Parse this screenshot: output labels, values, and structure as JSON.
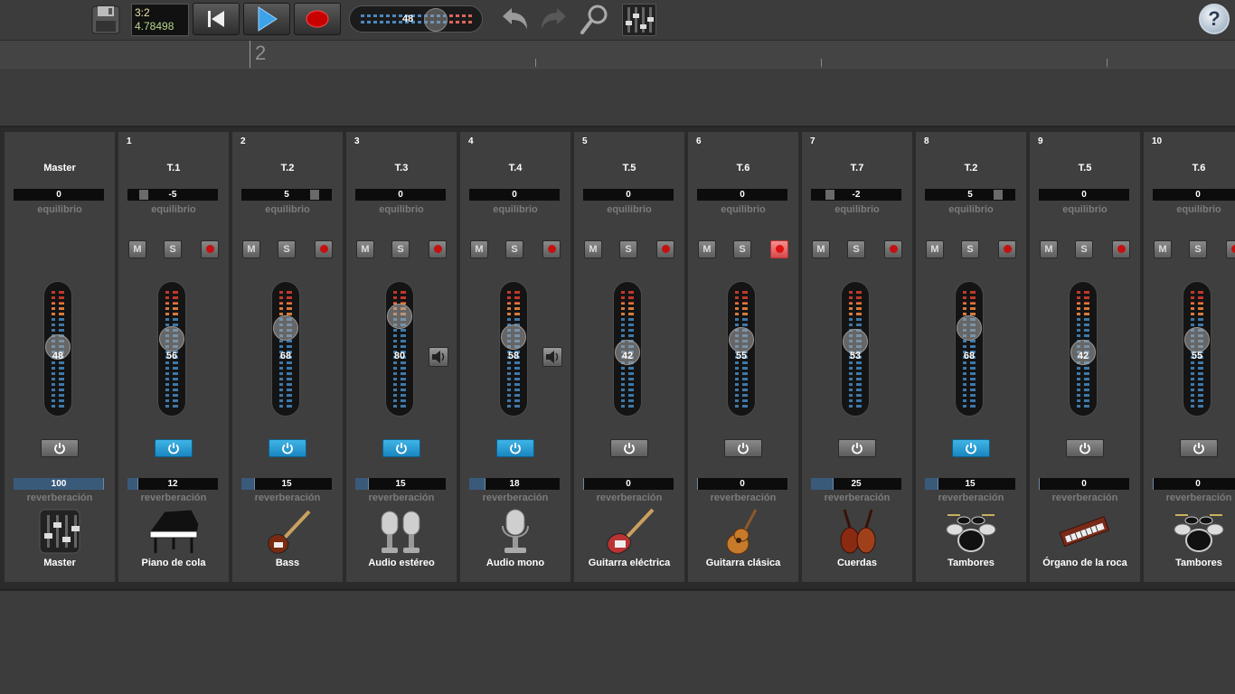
{
  "toolbar": {
    "timecode": {
      "bar_beat": "3:2",
      "seconds": "4.78498"
    },
    "tempo": "48"
  },
  "ruler": {
    "bar_number": "2"
  },
  "labels": {
    "balance": "equilibrio",
    "reverb": "reverberación",
    "mute": "M",
    "solo": "S"
  },
  "colors": {
    "power_on": "#2a9ad6",
    "record_armed": "#e06060",
    "meter_low": "#3e78a8",
    "meter_high": "#c0392b"
  },
  "strips": [
    {
      "number": "",
      "name": "Master",
      "balance": "0",
      "volume": "48",
      "reverb": "100",
      "reverb_level": 1.0,
      "power_on": false,
      "armed": false,
      "monitor": false,
      "instrument_name": "Master",
      "icon": "mixer-icon"
    },
    {
      "number": "1",
      "name": "T.1",
      "balance": "-5",
      "volume": "56",
      "reverb": "12",
      "reverb_level": 0.12,
      "power_on": true,
      "armed": false,
      "monitor": false,
      "instrument_name": "Piano de cola",
      "icon": "grand-piano-icon"
    },
    {
      "number": "2",
      "name": "T.2",
      "balance": "5",
      "volume": "68",
      "reverb": "15",
      "reverb_level": 0.15,
      "power_on": true,
      "armed": false,
      "monitor": false,
      "instrument_name": "Bass",
      "icon": "bass-guitar-icon"
    },
    {
      "number": "3",
      "name": "T.3",
      "balance": "0",
      "volume": "80",
      "reverb": "15",
      "reverb_level": 0.15,
      "power_on": true,
      "armed": false,
      "monitor": true,
      "instrument_name": "Audio estéreo",
      "icon": "stereo-microphone-icon"
    },
    {
      "number": "4",
      "name": "T.4",
      "balance": "0",
      "volume": "58",
      "reverb": "18",
      "reverb_level": 0.18,
      "power_on": true,
      "armed": false,
      "monitor": true,
      "instrument_name": "Audio mono",
      "icon": "microphone-icon"
    },
    {
      "number": "5",
      "name": "T.5",
      "balance": "0",
      "volume": "42",
      "reverb": "0",
      "reverb_level": 0,
      "power_on": false,
      "armed": false,
      "monitor": false,
      "instrument_name": "Guitarra eléctrica",
      "icon": "electric-guitar-icon"
    },
    {
      "number": "6",
      "name": "T.6",
      "balance": "0",
      "volume": "55",
      "reverb": "0",
      "reverb_level": 0,
      "power_on": false,
      "armed": true,
      "monitor": false,
      "instrument_name": "Guitarra clásica",
      "icon": "acoustic-guitar-icon"
    },
    {
      "number": "7",
      "name": "T.7",
      "balance": "-2",
      "volume": "53",
      "reverb": "25",
      "reverb_level": 0.25,
      "power_on": false,
      "armed": false,
      "monitor": false,
      "instrument_name": "Cuerdas",
      "icon": "violin-icon"
    },
    {
      "number": "8",
      "name": "T.2",
      "balance": "5",
      "volume": "68",
      "reverb": "15",
      "reverb_level": 0.15,
      "power_on": true,
      "armed": false,
      "monitor": false,
      "instrument_name": "Tambores",
      "icon": "drum-kit-icon"
    },
    {
      "number": "9",
      "name": "T.5",
      "balance": "0",
      "volume": "42",
      "reverb": "0",
      "reverb_level": 0,
      "power_on": false,
      "armed": false,
      "monitor": false,
      "instrument_name": "Órgano de la roca",
      "icon": "organ-icon"
    },
    {
      "number": "10",
      "name": "T.6",
      "balance": "0",
      "volume": "55",
      "reverb": "0",
      "reverb_level": 0,
      "power_on": false,
      "armed": false,
      "monitor": false,
      "instrument_name": "Tambores",
      "icon": "drum-kit-icon"
    }
  ]
}
